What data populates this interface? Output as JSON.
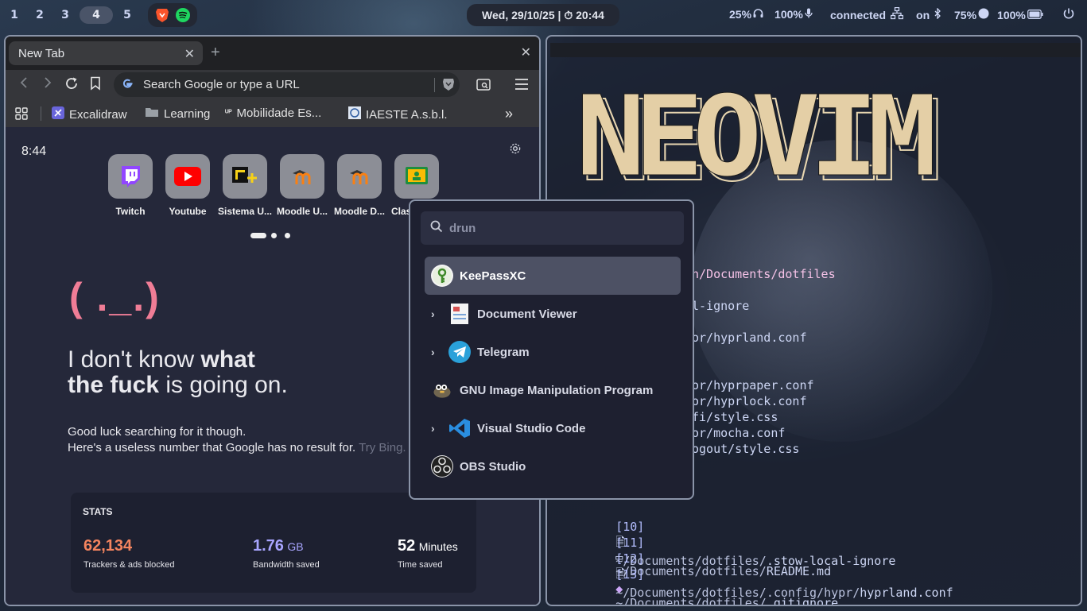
{
  "topbar": {
    "workspaces": [
      "1",
      "2",
      "3",
      "4",
      "5"
    ],
    "active_workspace": "4",
    "clock": "Wed, 29/10/25 | ⏱ 20:44",
    "volume": "25%",
    "mic": "100%",
    "network": "connected",
    "bluetooth": "on",
    "brightness": "75%",
    "battery": "100%"
  },
  "browser": {
    "tab_title": "New Tab",
    "search_placeholder": "Search Google or type a URL",
    "bookmarks": [
      "Excalidraw",
      "Learning",
      "Mobilidade Es...",
      "IAESTE A.s.b.l."
    ],
    "time": "8:44",
    "tiles": [
      "Twitch",
      "Youtube",
      "Sistema U...",
      "Moodle U...",
      "Moodle D...",
      "Clas"
    ],
    "face": "( ._.)",
    "headline_1": "I don't know ",
    "headline_1b": "what",
    "headline_2b": "the fuck",
    "headline_2": " is going on.",
    "sub_1": "Good luck searching for it though.",
    "sub_2": "Here's a useless number that Google has no result for. ",
    "sub_2_muted": "Try Bing.",
    "stats": {
      "title": "STATS",
      "trackers": "62,134",
      "trackers_caption": "Trackers & ads blocked",
      "bandwidth": "1.76",
      "bandwidth_unit": "GB",
      "bandwidth_caption": "Bandwidth saved",
      "time": "52",
      "time_unit": "Minutes",
      "time_caption": "Time saved"
    },
    "colors": {
      "trackers": "#f4845f",
      "bandwidth": "#a8a5ff",
      "time": "#ffffff"
    }
  },
  "terminal": {
    "logo": "NEOVIM",
    "partial_lines": [
      "n/Documents/dotfiles",
      "l-ignore",
      "or/hyprland.conf",
      "or/hyprpaper.conf",
      "or/hyprlock.conf",
      "fi/style.css",
      "or/mocha.conf",
      "ogout/style.css"
    ],
    "recent": [
      {
        "num": "[10]",
        "path": "~/Documents/dotfiles/",
        "file": ".stow-local-ignore"
      },
      {
        "num": "[11]",
        "path": "~/Documents/dotfiles/",
        "file": "README.md"
      },
      {
        "num": "[12]",
        "path": "~/Documents/dotfiles/.config/hypr/",
        "file": "hyprland.conf"
      },
      {
        "num": "[13]",
        "path": "~/Documents/dotfiles/",
        "file": ".gitignore"
      }
    ]
  },
  "launcher": {
    "placeholder": "drun",
    "entries": [
      "KeePassXC",
      "Document Viewer",
      "Telegram",
      "GNU Image Manipulation Program",
      "Visual Studio Code",
      "OBS Studio"
    ]
  }
}
